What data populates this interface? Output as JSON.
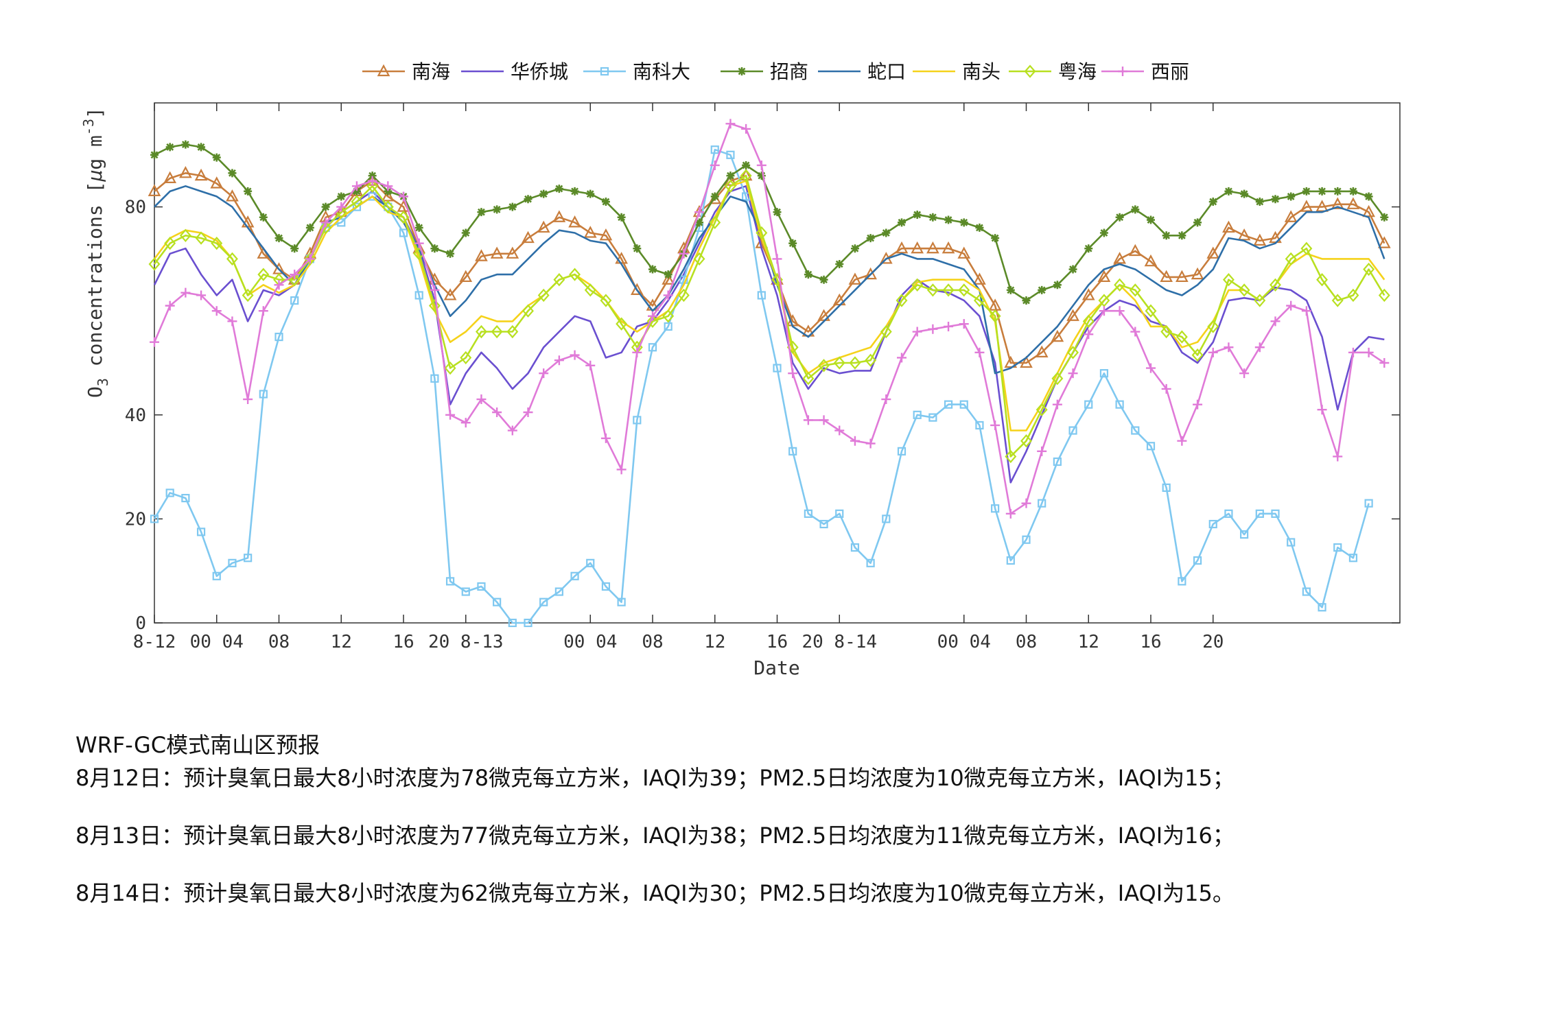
{
  "chart_data": {
    "type": "line",
    "xlabel": "Date",
    "ylabel": "O3 concentrations [μg m-3]",
    "ylim": [
      0,
      100
    ],
    "yticks": [
      0,
      20,
      40,
      80
    ],
    "x_ticks": [
      {
        "pos": 0,
        "label": "8-12"
      },
      {
        "pos": 4,
        "label": "00 04"
      },
      {
        "pos": 8,
        "label": "08"
      },
      {
        "pos": 12,
        "label": "12"
      },
      {
        "pos": 16,
        "label": "16"
      },
      {
        "pos": 20,
        "label": "20 8-13"
      },
      {
        "pos": 28,
        "label": "00 04"
      },
      {
        "pos": 32,
        "label": "08"
      },
      {
        "pos": 36,
        "label": "12"
      },
      {
        "pos": 40,
        "label": "16"
      },
      {
        "pos": 44,
        "label": "20 8-14"
      },
      {
        "pos": 52,
        "label": "00 04"
      },
      {
        "pos": 56,
        "label": "08"
      },
      {
        "pos": 60,
        "label": "12"
      },
      {
        "pos": 64,
        "label": "16"
      },
      {
        "pos": 68,
        "label": "20"
      }
    ],
    "x": [
      0,
      1,
      2,
      3,
      4,
      5,
      6,
      7,
      8,
      9,
      10,
      11,
      12,
      13,
      14,
      15,
      16,
      17,
      18,
      19,
      20,
      21,
      22,
      23,
      24,
      25,
      26,
      27,
      28,
      29,
      30,
      31,
      32,
      33,
      34,
      35,
      36,
      37,
      38,
      39,
      40,
      41,
      42,
      43,
      44,
      45,
      46,
      47,
      48,
      49,
      50,
      51,
      52,
      53,
      54,
      55,
      56,
      57,
      58,
      59,
      60,
      61,
      62,
      63,
      64,
      65,
      66,
      67,
      68,
      69,
      70,
      71,
      72,
      73,
      74,
      75,
      76,
      77,
      78,
      79,
      80
    ],
    "legend_position": "top",
    "grid": false,
    "series": [
      {
        "name": "南海",
        "color": "#c87d3c",
        "marker": "triangle",
        "values": [
          83,
          85.5,
          86.5,
          86,
          84.5,
          82,
          77,
          71,
          68,
          66,
          71,
          78,
          79,
          83,
          85,
          82,
          80,
          72,
          66,
          63,
          66.5,
          70.5,
          71,
          71,
          74,
          76,
          78,
          77,
          75,
          74.5,
          70,
          64,
          61,
          66,
          72,
          79,
          81.5,
          85,
          86,
          73,
          66,
          58,
          56,
          59,
          62,
          66,
          67,
          70,
          72,
          72,
          72,
          72,
          71,
          66,
          61,
          50,
          50,
          52,
          55,
          59,
          63,
          66.5,
          70,
          71.5,
          69.5,
          66.5,
          66.5,
          67,
          71,
          76,
          74.5,
          73.5,
          74,
          78,
          80,
          80,
          80.5,
          80.5,
          79,
          73
        ]
      },
      {
        "name": "华侨城",
        "color": "#6a4fd0",
        "values": [
          65,
          71,
          72,
          67,
          63,
          66,
          58,
          64,
          63,
          65,
          70,
          76,
          79,
          81,
          83,
          80,
          78,
          72,
          62,
          42,
          48,
          52,
          49,
          45,
          48,
          53,
          56,
          59,
          58,
          51,
          52,
          57,
          58,
          62,
          67,
          73,
          79,
          83,
          84,
          72,
          63,
          50,
          45,
          49,
          48,
          48.5,
          48.5,
          56,
          63,
          66,
          64,
          63.5,
          62,
          59,
          50,
          27,
          33,
          40,
          47,
          52,
          57,
          60,
          62,
          61,
          58,
          57,
          52,
          50,
          54,
          62,
          62.5,
          62,
          64.5,
          64,
          62,
          55,
          41,
          52,
          55,
          54.5
        ]
      },
      {
        "name": "南科大",
        "color": "#7fc8f0",
        "marker": "square",
        "values": [
          20,
          25,
          24,
          17.5,
          9,
          11.5,
          12.5,
          44,
          55,
          62,
          70,
          76,
          77,
          80,
          82,
          80,
          75,
          63,
          47,
          8,
          6,
          7,
          4,
          0,
          0,
          4,
          6,
          9,
          11.5,
          7,
          4,
          39,
          53,
          57,
          66,
          76,
          91,
          90,
          82,
          63,
          49,
          33,
          21,
          19,
          21,
          14.5,
          11.5,
          20,
          33,
          40,
          39.5,
          42,
          42,
          38,
          22,
          12,
          16,
          23,
          31,
          37,
          42,
          48,
          42,
          37,
          34,
          26,
          8,
          12,
          19,
          21,
          17,
          21,
          21,
          15.5,
          6,
          3,
          14.5,
          12.5,
          23
        ]
      },
      {
        "name": "招商",
        "color": "#5b8a28",
        "marker": "star",
        "values": [
          90,
          91.5,
          92,
          91.5,
          89.5,
          86.5,
          83,
          78,
          74,
          72,
          76,
          80,
          82,
          83,
          86,
          83,
          82,
          76,
          72,
          71,
          75,
          79,
          79.5,
          80,
          81.5,
          82.5,
          83.5,
          83,
          82.5,
          81,
          78,
          72,
          68,
          67,
          71,
          77,
          82,
          86,
          88,
          86,
          79,
          73,
          67,
          66,
          69,
          72,
          74,
          75,
          77,
          78.5,
          78,
          77.5,
          77,
          76,
          74,
          64,
          62,
          64,
          65,
          68,
          72,
          75,
          78,
          79.5,
          77.5,
          74.5,
          74.5,
          77,
          81,
          83,
          82.5,
          81,
          81.5,
          82,
          83,
          83,
          83,
          83,
          82,
          78
        ]
      },
      {
        "name": "蛇口",
        "color": "#2e6fa8",
        "values": [
          80,
          83,
          84,
          83,
          82,
          80,
          76,
          72,
          68,
          65,
          70,
          77,
          78,
          80,
          82,
          80,
          77,
          72,
          65,
          59,
          62,
          66,
          67,
          67,
          70,
          73,
          75.5,
          75,
          73.5,
          73,
          69,
          64,
          60,
          63,
          68,
          74,
          78,
          82,
          81,
          75,
          65,
          57,
          55,
          58,
          61,
          64,
          67,
          70,
          71,
          70,
          70,
          69,
          68,
          64,
          48,
          49,
          51,
          54,
          57,
          61,
          65,
          68,
          69,
          68,
          66,
          64,
          63,
          65,
          68,
          74,
          73.5,
          72,
          73,
          76,
          79,
          79,
          80,
          79,
          78,
          70
        ]
      },
      {
        "name": "南头",
        "color": "#f5d21a",
        "values": [
          70,
          74,
          75.5,
          75,
          73.5,
          70,
          63,
          65,
          63.5,
          65,
          69,
          75,
          78,
          80,
          82,
          79,
          78,
          70,
          60,
          54,
          56,
          59,
          58,
          58,
          61,
          63,
          66,
          67,
          65,
          62,
          58,
          56,
          58,
          60,
          65,
          72,
          78,
          84,
          85,
          74,
          66,
          52,
          48,
          50,
          51,
          52,
          53,
          57,
          62,
          65.5,
          66,
          66,
          66,
          64,
          58,
          37,
          37,
          42,
          48,
          54,
          59,
          62,
          65,
          62,
          57,
          57,
          53,
          54,
          58,
          64,
          64,
          62,
          65,
          69,
          71,
          70,
          70,
          70,
          70,
          66
        ]
      },
      {
        "name": "粤海",
        "color": "#b8e020",
        "marker": "diamond",
        "values": [
          69,
          73,
          74.5,
          74,
          73,
          70,
          63,
          67,
          66,
          66,
          70,
          76,
          79,
          81,
          84,
          80,
          78,
          71,
          61,
          49,
          51,
          56,
          56,
          56,
          60,
          63,
          66,
          67,
          64,
          62,
          57.5,
          53,
          58,
          59,
          63,
          70,
          77,
          84,
          86,
          75,
          66,
          53,
          47,
          49.5,
          50,
          50,
          50.5,
          56,
          62,
          65,
          64,
          64,
          64,
          62,
          59,
          32,
          35,
          41,
          47,
          52,
          58,
          62,
          65,
          64,
          60,
          56,
          55,
          51.5,
          57,
          66,
          64,
          62,
          65,
          70,
          72,
          66,
          62,
          63,
          68,
          63
        ]
      },
      {
        "name": "西丽",
        "color": "#e07ad8",
        "marker": "plus",
        "values": [
          54,
          61,
          63.5,
          63,
          60,
          58,
          43,
          60,
          65,
          67,
          70,
          77,
          80,
          84,
          85,
          84,
          82,
          73,
          64,
          40,
          38.5,
          43,
          40.5,
          37,
          40.5,
          48,
          50.5,
          51.5,
          49.5,
          35.5,
          29.5,
          52,
          59,
          63,
          71,
          79,
          88,
          96,
          95,
          88,
          70,
          48,
          39,
          39,
          37,
          35,
          34.5,
          43,
          51,
          56,
          56.5,
          57,
          57.5,
          52,
          38,
          21,
          23,
          33,
          42,
          48,
          55.5,
          60,
          60,
          56,
          49,
          45,
          35,
          42,
          52,
          53,
          48,
          53,
          58,
          61,
          60,
          41,
          32,
          52,
          52,
          50
        ]
      }
    ]
  },
  "report": {
    "title": "WRF-GC模式南山区预报",
    "lines": [
      "8月12日：预计臭氧日最大8小时浓度为78微克每立方米，IAQI为39；PM2.5日均浓度为10微克每立方米，IAQI为15；",
      "8月13日：预计臭氧日最大8小时浓度为77微克每立方米，IAQI为38；PM2.5日均浓度为11微克每立方米，IAQI为16；",
      "8月14日：预计臭氧日最大8小时浓度为62微克每立方米，IAQI为30；PM2.5日均浓度为10微克每立方米，IAQI为15。"
    ]
  }
}
